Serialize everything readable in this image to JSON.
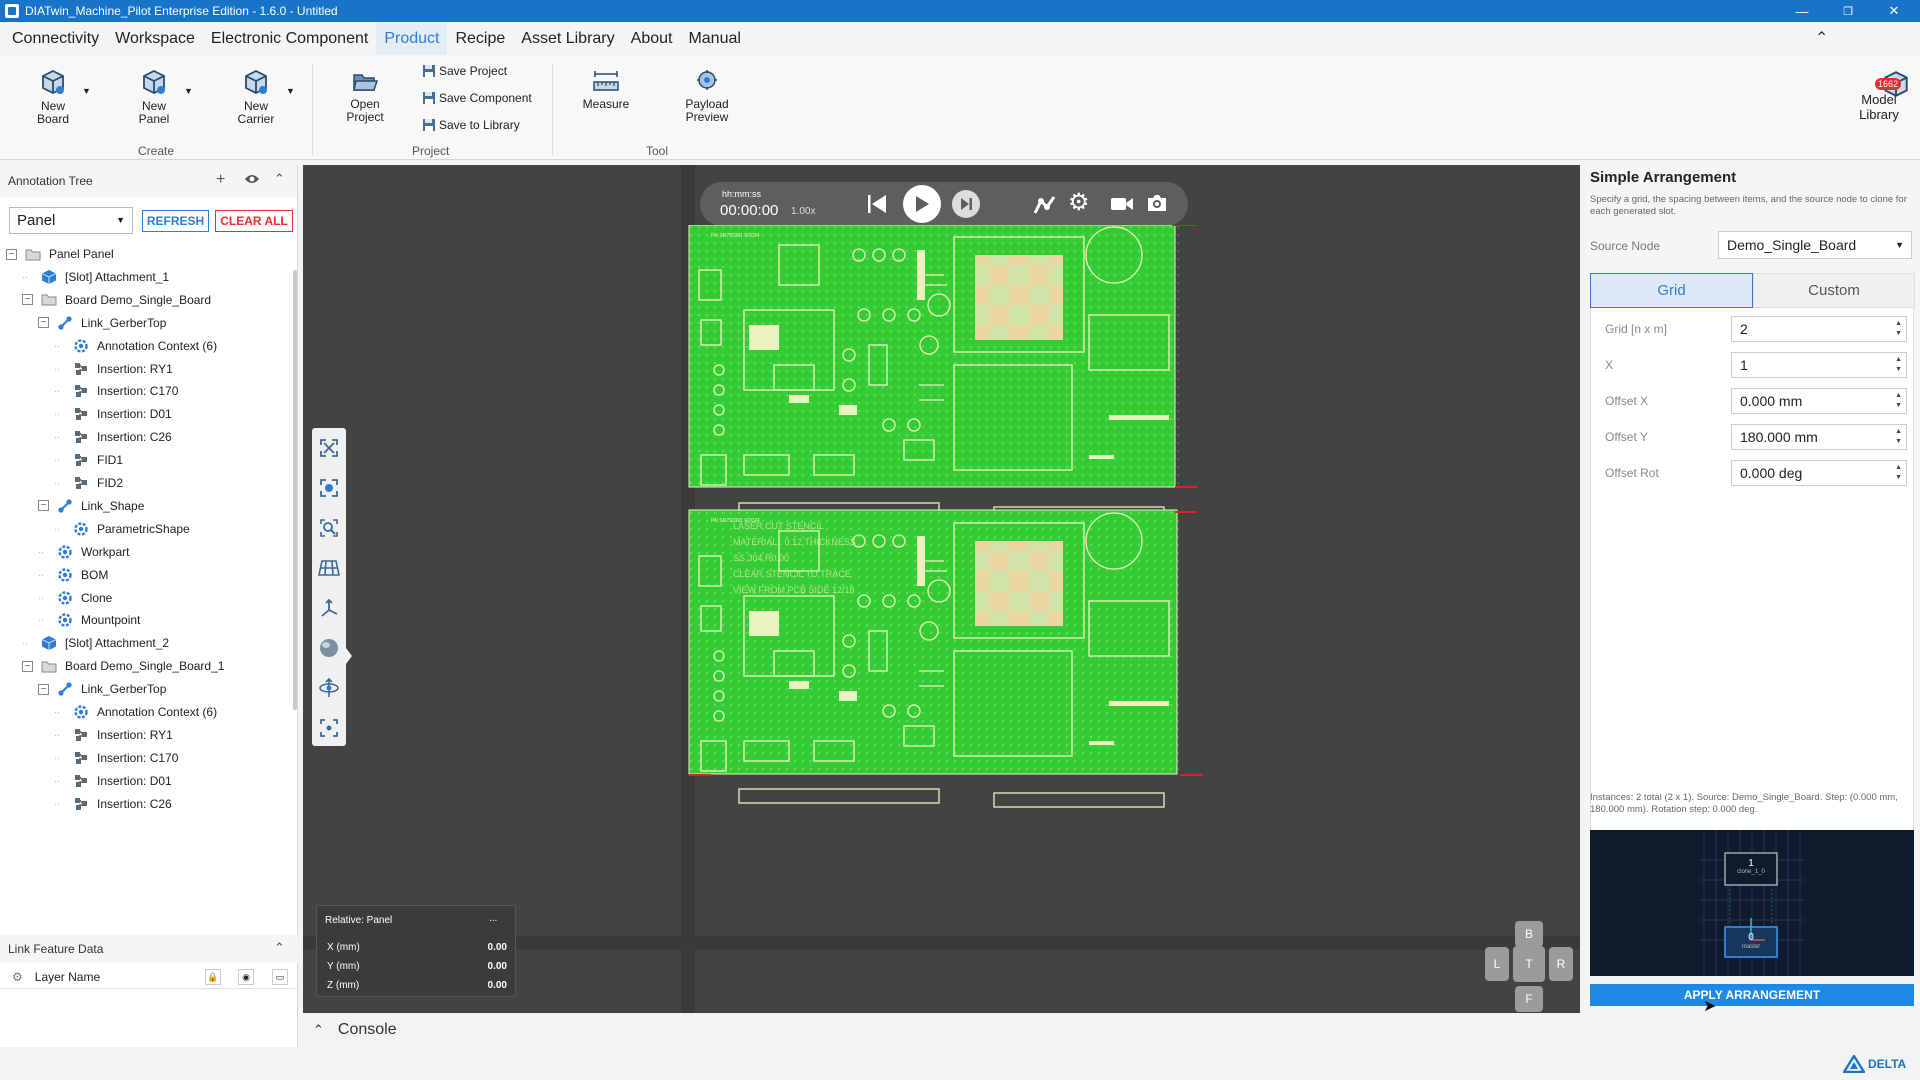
{
  "window": {
    "title": "DIATwin_Machine_Pilot Enterprise Edition - 1.6.0 - Untitled"
  },
  "menu": [
    "Connectivity",
    "Workspace",
    "Electronic Component",
    "Product",
    "Recipe",
    "Asset Library",
    "About",
    "Manual"
  ],
  "menu_active": "Product",
  "ribbon": {
    "new_board": "New\nBoard",
    "new_panel": "New\nPanel",
    "new_carrier": "New\nCarrier",
    "create_group": "Create",
    "open_project": "Open\nProject",
    "save_project": "Save Project",
    "save_component": "Save Component",
    "save_to_library": "Save to Library",
    "project_group": "Project",
    "measure": "Measure",
    "payload_preview": "Payload\nPreview",
    "tool_group": "Tool",
    "model_library": "Model\nLibrary",
    "model_library_badge": "1662"
  },
  "annotation_tree": {
    "title": "Annotation Tree",
    "dropdown_value": "Panel",
    "refresh": "REFRESH",
    "clear_all": "CLEAR ALL",
    "rows": [
      {
        "label": "Panel  Panel",
        "icon": "folder"
      },
      {
        "label": "[Slot] Attachment_1",
        "icon": "cube"
      },
      {
        "label": "Board  Demo_Single_Board",
        "icon": "folder"
      },
      {
        "label": "Link_GerberTop",
        "icon": "link"
      },
      {
        "label": "Annotation Context (6)",
        "icon": "gear"
      },
      {
        "label": "Insertion: RY1",
        "icon": "component"
      },
      {
        "label": "Insertion: C170",
        "icon": "component"
      },
      {
        "label": "Insertion: D01",
        "icon": "component"
      },
      {
        "label": "Insertion: C26",
        "icon": "component"
      },
      {
        "label": "FID1",
        "icon": "component"
      },
      {
        "label": "FID2",
        "icon": "component"
      },
      {
        "label": "Link_Shape",
        "icon": "link"
      },
      {
        "label": "ParametricShape",
        "icon": "gear"
      },
      {
        "label": "Workpart",
        "icon": "gear"
      },
      {
        "label": "BOM",
        "icon": "gear"
      },
      {
        "label": "Clone",
        "icon": "gear"
      },
      {
        "label": "Mountpoint",
        "icon": "gear"
      },
      {
        "label": "[Slot] Attachment_2",
        "icon": "cube"
      },
      {
        "label": "Board  Demo_Single_Board_1",
        "icon": "folder"
      },
      {
        "label": "Link_GerberTop",
        "icon": "link"
      },
      {
        "label": "Annotation Context (6)",
        "icon": "gear"
      },
      {
        "label": "Insertion: RY1",
        "icon": "component"
      },
      {
        "label": "Insertion: C170",
        "icon": "component"
      },
      {
        "label": "Insertion: D01",
        "icon": "component"
      },
      {
        "label": "Insertion: C26",
        "icon": "component"
      }
    ]
  },
  "link_feature": {
    "title": "Link Feature Data",
    "layer_name": "Layer Name"
  },
  "player": {
    "time_label": "hh:mm:ss",
    "time": "00:00:00",
    "speed": "1.00x"
  },
  "coords": {
    "title": "Relative: Panel",
    "more": "...",
    "x_label": "X (mm)",
    "x": "0.00",
    "y_label": "Y (mm)",
    "y": "0.00",
    "z_label": "Z (mm)",
    "z": "0.00"
  },
  "nav": {
    "b": "B",
    "l": "L",
    "t": "T",
    "r": "R",
    "f": "F"
  },
  "board_text": {
    "small_label_1": "PN SN750301  6/2024",
    "small_label_2": "PN SN750301  6/2024",
    "stencil_1": "LASER CUT STENCIL",
    "stencil_2": "MATERIAL : 0.12 THICKNESS",
    "stencil_3": "SS 304 R0.00",
    "stencil_4": "CLEAR STENCIL TO TRACE",
    "stencil_5": "VIEW FROM PCB SIDE 12/18"
  },
  "console": {
    "label": "Console"
  },
  "arrangement": {
    "title": "Simple Arrangement",
    "description": "Specify a grid, the spacing between items, and the source node to clone for each generated slot.",
    "source_label": "Source Node",
    "source_value": "Demo_Single_Board",
    "tab_grid": "Grid",
    "tab_custom": "Custom",
    "grid_label": "Grid [n x m]",
    "grid_value": "2",
    "x_label": "X",
    "x_value": "1",
    "offx_label": "Offset X",
    "offx_value": "0.000 mm",
    "offy_label": "Offset Y",
    "offy_value": "180.000 mm",
    "offrot_label": "Offset Rot",
    "offrot_value": "0.000 deg",
    "summary": "Instances: 2 total (2 x 1). Source: Demo_Single_Board. Step: (0.000 mm, 180.000 mm). Rotation step: 0.000 deg.",
    "preview_top_num": "1",
    "preview_top_label": "clone_1_0",
    "preview_bottom_num": "0",
    "preview_bottom_label": "master",
    "apply": "APPLY ARRANGEMENT"
  },
  "brand": "DELTA",
  "colors": {
    "accent": "#1874c8",
    "board_green": "#33cc33",
    "viewport": "#434343",
    "clear_red": "#e03030"
  }
}
